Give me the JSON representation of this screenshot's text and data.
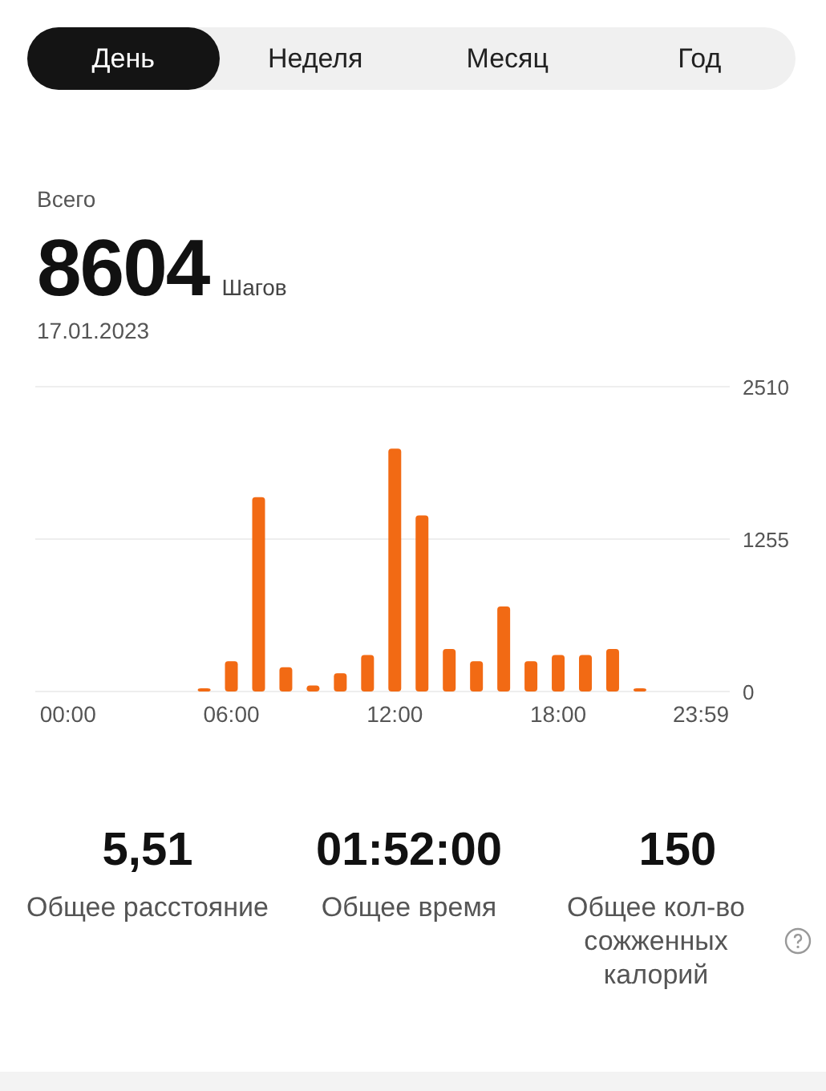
{
  "tabs": [
    {
      "label": "День",
      "selected": true
    },
    {
      "label": "Неделя",
      "selected": false
    },
    {
      "label": "Месяц",
      "selected": false
    },
    {
      "label": "Год",
      "selected": false
    }
  ],
  "summary": {
    "label": "Всего",
    "value": "8604",
    "unit": "Шагов",
    "date": "17.01.2023"
  },
  "chart": {
    "chart_data": {
      "type": "bar",
      "x": [
        0,
        1,
        2,
        3,
        4,
        5,
        6,
        7,
        8,
        9,
        10,
        11,
        12,
        13,
        14,
        15,
        16,
        17,
        18,
        19,
        20,
        21,
        22,
        23
      ],
      "xlim": [
        -1.2,
        24.3
      ],
      "series": [
        {
          "color": "#f26a14",
          "values": [
            0,
            0,
            0,
            0,
            0,
            20,
            250,
            1600,
            200,
            50,
            150,
            300,
            2000,
            1450,
            350,
            250,
            700,
            250,
            300,
            300,
            350,
            20,
            0,
            0
          ]
        }
      ],
      "ylim": [
        0,
        2510
      ],
      "yticks": [
        0,
        1255,
        2510
      ],
      "xticks": [
        {
          "value": 0,
          "label": "00:00"
        },
        {
          "value": 6,
          "label": "06:00"
        },
        {
          "value": 12,
          "label": "12:00"
        },
        {
          "value": 18,
          "label": "18:00"
        },
        {
          "value": 23.98,
          "label": "23:59"
        }
      ]
    }
  },
  "stats": [
    {
      "value": "5,51",
      "label": "Общее расстояние",
      "help": false
    },
    {
      "value": "01:52:00",
      "label": "Общее время",
      "help": false
    },
    {
      "value": "150",
      "label": "Общее кол-во сожженных калорий",
      "help": true
    }
  ]
}
